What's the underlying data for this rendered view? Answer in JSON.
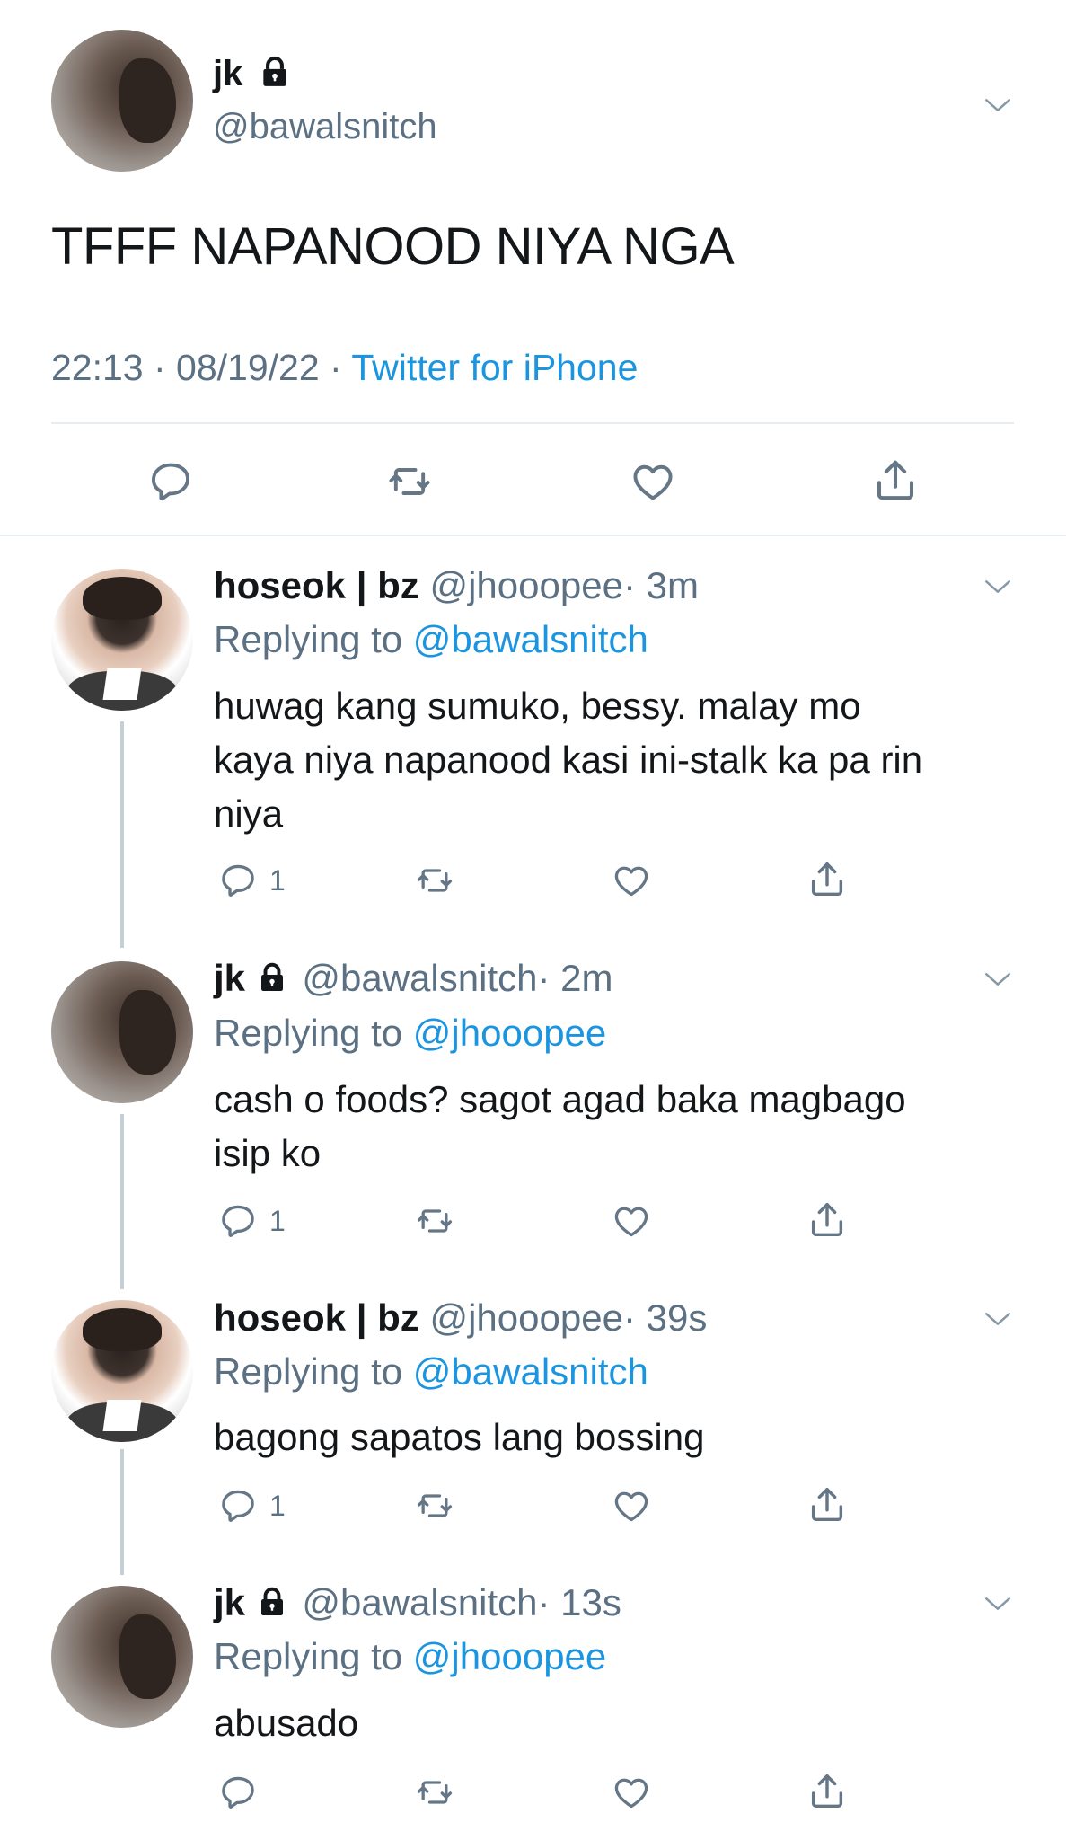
{
  "main_tweet": {
    "name": "jk",
    "handle": "@bawalsnitch",
    "text": "TFFF NAPANOOD NIYA NGA",
    "time": "22:13 · 08/19/22 ·",
    "source": "Twitter for iPhone"
  },
  "replies": [
    {
      "name": "hoseok | bz",
      "handle": "@jhooopee",
      "time": "· 3m",
      "replying_prefix": "Replying to",
      "replying_to": "@bawalsnitch",
      "text_lines": [
        "huwag kang sumuko, bessy. malay mo",
        "kaya niya napanood kasi ini-stalk ka pa rin",
        "niya"
      ],
      "reply_count": "1"
    },
    {
      "name": "jk",
      "handle": "@bawalsnitch",
      "time": "· 2m",
      "replying_prefix": "Replying to",
      "replying_to": "@jhooopee",
      "text_lines": [
        "cash o foods? sagot agad baka magbago",
        "isip ko"
      ],
      "reply_count": "1"
    },
    {
      "name": "hoseok | bz",
      "handle": "@jhooopee",
      "time": "· 39s",
      "replying_prefix": "Replying to",
      "replying_to": "@bawalsnitch",
      "text_lines": [
        "bagong sapatos lang bossing"
      ],
      "reply_count": "1"
    },
    {
      "name": "jk",
      "handle": "@bawalsnitch",
      "time": "· 13s",
      "replying_prefix": "Replying to",
      "replying_to": "@jhooopee",
      "text_lines": [
        "abusado"
      ],
      "reply_count": ""
    }
  ],
  "icons": {
    "reply": "reply-icon",
    "retweet": "retweet-icon",
    "like": "like-icon",
    "share": "share-icon",
    "more": "chevron-down-icon",
    "lock": "lock-icon"
  },
  "colors": {
    "link_blue": "#1b95e0",
    "secondary_grey": "#5b7083",
    "icon_grey": "#657786",
    "thread_line": "#c4cfd6"
  }
}
